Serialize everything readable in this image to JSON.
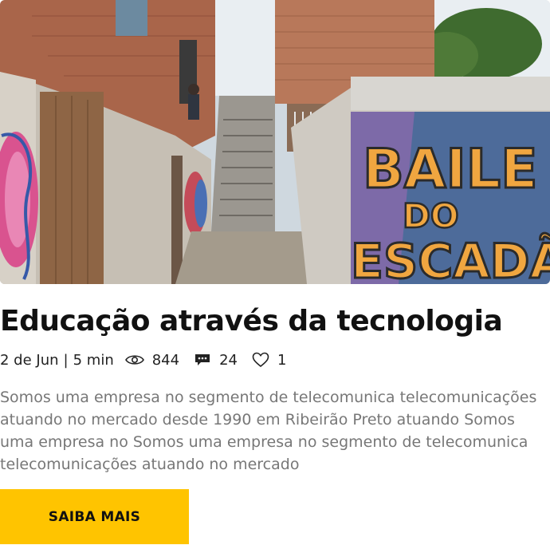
{
  "post": {
    "title": "Educação através da tecnologia",
    "date": "2 de Jun",
    "separator": "|",
    "read_time": "5 min",
    "views": "844",
    "comments": "24",
    "likes": "1",
    "excerpt": "Somos uma empresa no segmento de telecomunica telecomunicações atuando no mercado desde 1990 em Ribeirão Preto atuando Somos uma empresa no Somos uma empresa no segmento de telecomunica telecomunicações atuando no mercado",
    "cta_label": "SAIBA MAIS",
    "image": {
      "subject": "favela-staircase-with-graffiti",
      "graffiti_text": "BAILE DO ESCADÃO"
    }
  },
  "colors": {
    "accent": "#FFC400",
    "text": "#111111",
    "muted": "#777777"
  },
  "icons": {
    "views": "eye-icon",
    "comments": "comment-icon",
    "likes": "heart-icon"
  }
}
